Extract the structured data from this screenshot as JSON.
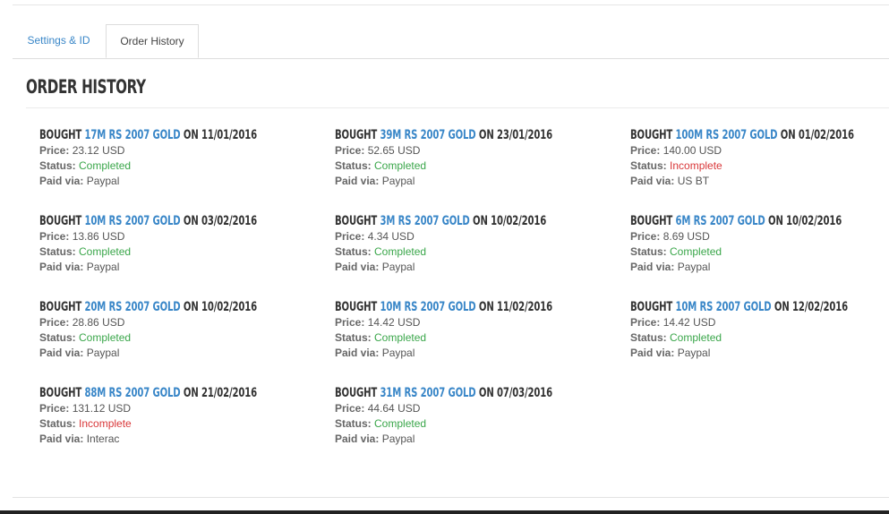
{
  "tabs": [
    {
      "label": "Settings & ID",
      "active": false
    },
    {
      "label": "Order History",
      "active": true
    }
  ],
  "heading": "Order History",
  "labels": {
    "bought": "Bought",
    "on": "on",
    "price": "Price:",
    "status": "Status:",
    "paid_via": "Paid via:"
  },
  "colors": {
    "link": "#3a87c8",
    "completed": "#3aa64a",
    "incomplete": "#d9383a"
  },
  "orders": [
    {
      "product": "17M RS 2007 Gold",
      "date": "11/01/2016",
      "price": "23.12 USD",
      "status": "Completed",
      "paid_via": "Paypal"
    },
    {
      "product": "39M RS 2007 Gold",
      "date": "23/01/2016",
      "price": "52.65 USD",
      "status": "Completed",
      "paid_via": "Paypal"
    },
    {
      "product": "100M RS 2007 Gold",
      "date": "01/02/2016",
      "price": "140.00 USD",
      "status": "Incomplete",
      "paid_via": "US BT"
    },
    {
      "product": "10M RS 2007 Gold",
      "date": "03/02/2016",
      "price": "13.86 USD",
      "status": "Completed",
      "paid_via": "Paypal"
    },
    {
      "product": "3M RS 2007 Gold",
      "date": "10/02/2016",
      "price": "4.34 USD",
      "status": "Completed",
      "paid_via": "Paypal"
    },
    {
      "product": "6M RS 2007 Gold",
      "date": "10/02/2016",
      "price": "8.69 USD",
      "status": "Completed",
      "paid_via": "Paypal"
    },
    {
      "product": "20M RS 2007 Gold",
      "date": "10/02/2016",
      "price": "28.86 USD",
      "status": "Completed",
      "paid_via": "Paypal"
    },
    {
      "product": "10M RS 2007 Gold",
      "date": "11/02/2016",
      "price": "14.42 USD",
      "status": "Completed",
      "paid_via": "Paypal"
    },
    {
      "product": "10M RS 2007 Gold",
      "date": "12/02/2016",
      "price": "14.42 USD",
      "status": "Completed",
      "paid_via": "Paypal"
    },
    {
      "product": "88M RS 2007 Gold",
      "date": "21/02/2016",
      "price": "131.12 USD",
      "status": "Incomplete",
      "paid_via": "Interac"
    },
    {
      "product": "31M RS 2007 Gold",
      "date": "07/03/2016",
      "price": "44.64 USD",
      "status": "Completed",
      "paid_via": "Paypal"
    }
  ]
}
